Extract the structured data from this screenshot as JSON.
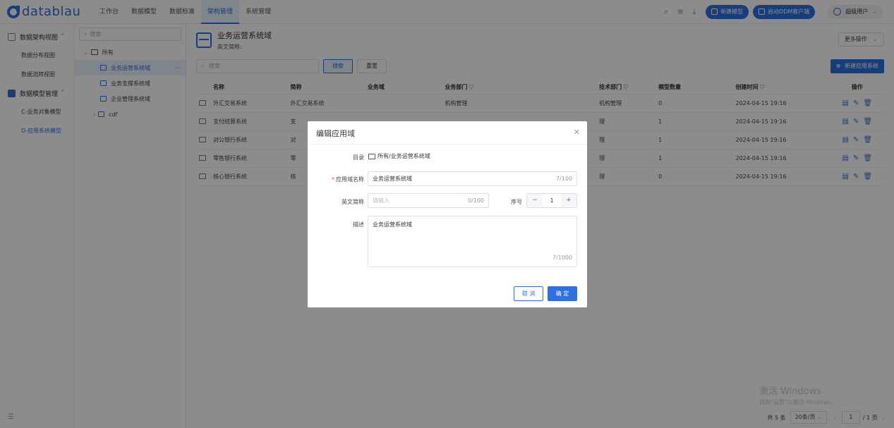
{
  "header": {
    "logo": "datablau",
    "nav": [
      "工作台",
      "数据模型",
      "数据标准",
      "架构管理",
      "系统管理"
    ],
    "active_nav": 3,
    "new_model": "新建模型",
    "start_ddm": "启动DDM客户端",
    "user": "超级用户"
  },
  "sidebar": {
    "group1": "数据架构视图",
    "group1_items": [
      "数据分布视图",
      "数据流转视图"
    ],
    "group2": "数据模型管理",
    "group2_items": [
      "C-业务对象模型",
      "D-应用系统模型"
    ]
  },
  "tree": {
    "search_placeholder": "搜索",
    "root": "所有",
    "items": [
      "业务运营系统域",
      "业务支撑系统域",
      "企业管理系统域",
      "cdf"
    ],
    "more": "···"
  },
  "main": {
    "title": "业务运营系统域",
    "subtitle": "英文简称:",
    "more_ops": "更多操作",
    "search_placeholder": "搜索",
    "search_btn": "搜索",
    "reset_btn": "重置",
    "new_app": "新建应用系统",
    "columns": [
      "名称",
      "简称",
      "业务域",
      "业务部门",
      "技术部门",
      "模型数量",
      "创建时间",
      "操作"
    ],
    "rows": [
      {
        "name": "外汇交易系统",
        "abbr": "外汇交易系统",
        "biz": "",
        "dept": "机构管理",
        "tech": "机构管理",
        "count": "0",
        "time": "2024-04-15 19:16"
      },
      {
        "name": "支付结算系统",
        "abbr": "支",
        "biz": "",
        "dept": "",
        "tech": "理",
        "count": "1",
        "time": "2024-04-15 19:16"
      },
      {
        "name": "对公银行系统",
        "abbr": "对",
        "biz": "",
        "dept": "",
        "tech": "理",
        "count": "1",
        "time": "2024-04-15 19:16"
      },
      {
        "name": "零售银行系统",
        "abbr": "零",
        "biz": "",
        "dept": "",
        "tech": "理",
        "count": "1",
        "time": "2024-04-15 19:16"
      },
      {
        "name": "核心银行系统",
        "abbr": "核",
        "biz": "",
        "dept": "",
        "tech": "理",
        "count": "0",
        "time": "2024-04-15 19:16"
      }
    ]
  },
  "pager": {
    "total": "共 5 条",
    "page_size": "20条/页",
    "page": "1",
    "pages": "/ 1 页"
  },
  "watermark": {
    "line1": "激活 Windows",
    "line2": "转到\"设置\"以激活 Windows。"
  },
  "dialog": {
    "title": "编辑应用域",
    "dir_label": "目录",
    "dir_value": "所有/业务运营系统域",
    "name_label": "应用域名称",
    "name_value": "业务运营系统域",
    "name_count": "7/100",
    "en_label": "英文简称",
    "en_placeholder": "请输入",
    "en_count": "0/100",
    "seq_label": "序号",
    "seq_value": "1",
    "desc_label": "描述",
    "desc_value": "业务运营系统域",
    "desc_count": "7/1000",
    "cancel": "取 消",
    "ok": "确 定"
  }
}
